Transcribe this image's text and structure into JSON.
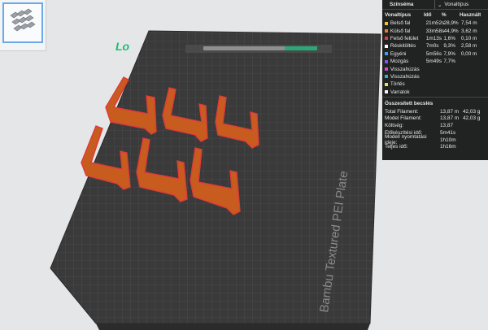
{
  "plate": {
    "label": "Lo",
    "brand_text": "Bambu Textured PEI Plate",
    "plate_color": "#3d3d3d",
    "model_color": "#c85b1e"
  },
  "legend": {
    "title": "Színséma",
    "selector_value": "Vonaltípus",
    "columns": [
      "Vonaltípus",
      "Idő",
      "%",
      "Használt"
    ],
    "rows": [
      {
        "name": "Belső fal",
        "time": "21m52s",
        "pct": "28,9%",
        "used": "7,54 m",
        "color": "#f2c230"
      },
      {
        "name": "Külső fal",
        "time": "33m58s",
        "pct": "44,9%",
        "used": "3,62 m",
        "color": "#f07a21"
      },
      {
        "name": "Felső felület",
        "time": "1m13s",
        "pct": "1,6%",
        "used": "0,10 m",
        "color": "#e33b3b"
      },
      {
        "name": "Réskitöltés",
        "time": "7m0s",
        "pct": "9,3%",
        "used": "2,58 m",
        "color": "#ffffff"
      },
      {
        "name": "Egyéni",
        "time": "5m56s",
        "pct": "7,9%",
        "used": "0,00 m",
        "color": "#3ca0e6"
      },
      {
        "name": "Mozgás",
        "time": "5m49s",
        "pct": "7,7%",
        "used": "",
        "color": "#7b56e8"
      },
      {
        "name": "Visszahúzás",
        "time": "",
        "pct": "",
        "used": "",
        "color": "#d147d1"
      },
      {
        "name": "Visszahúzás",
        "time": "",
        "pct": "",
        "used": "",
        "color": "#2fb1c4"
      },
      {
        "name": "Törlés",
        "time": "",
        "pct": "",
        "used": "",
        "color": "#e8e34a"
      },
      {
        "name": "Varratok",
        "time": "",
        "pct": "",
        "used": "",
        "color": "#f5f5f5"
      }
    ],
    "summary_title": "Összesített becslés",
    "summary": [
      {
        "label": "Total Filament:",
        "v1": "13,87 m",
        "v2": "42,03 g"
      },
      {
        "label": "Model Filament:",
        "v1": "13,87 m",
        "v2": "42,03 g"
      },
      {
        "label": "Költség:",
        "v1": "13,87",
        "v2": ""
      },
      {
        "label": "Előkészítési idő:",
        "v1": "5m41s",
        "v2": ""
      },
      {
        "label": "Modell nyomtatási ideje:",
        "v1": "1h10m",
        "v2": ""
      },
      {
        "label": "Teljes idő:",
        "v1": "1h16m",
        "v2": ""
      }
    ]
  }
}
